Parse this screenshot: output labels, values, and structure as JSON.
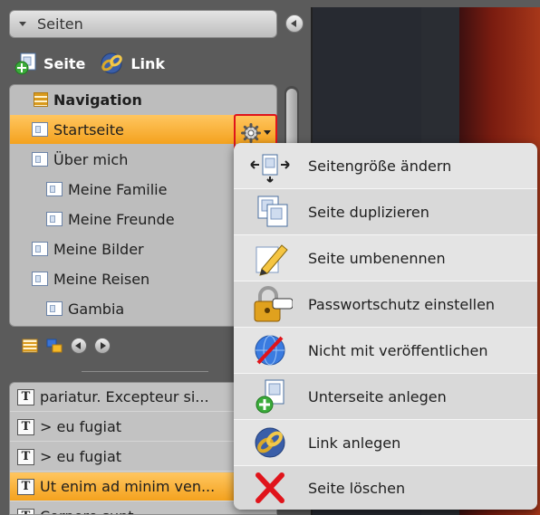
{
  "panel": {
    "section_title": "Seiten"
  },
  "toolbar": {
    "page_label": "Seite",
    "link_label": "Link"
  },
  "tree": {
    "items": [
      {
        "label": "Navigation",
        "level": 0,
        "type": "root"
      },
      {
        "label": "Startseite",
        "level": 0,
        "type": "page",
        "selected": true
      },
      {
        "label": "Über mich",
        "level": 0,
        "type": "page"
      },
      {
        "label": "Meine Familie",
        "level": 1,
        "type": "page"
      },
      {
        "label": "Meine Freunde",
        "level": 1,
        "type": "page"
      },
      {
        "label": "Meine Bilder",
        "level": 0,
        "type": "page"
      },
      {
        "label": "Meine Reisen",
        "level": 0,
        "type": "page"
      },
      {
        "label": "Gambia",
        "level": 1,
        "type": "page"
      }
    ]
  },
  "elements": {
    "items": [
      {
        "label": "pariatur. Excepteur si..."
      },
      {
        "label": "> eu fugiat"
      },
      {
        "label": "> eu fugiat"
      },
      {
        "label": "Ut enim ad minim ven...",
        "selected": true
      },
      {
        "label": "Corpore sunt"
      }
    ]
  },
  "context_menu": {
    "items": [
      {
        "label": "Seitengröße ändern",
        "icon": "resize-page-icon"
      },
      {
        "label": "Seite duplizieren",
        "icon": "duplicate-page-icon"
      },
      {
        "label": "Seite umbenennen",
        "icon": "rename-pencil-icon"
      },
      {
        "label": "Passwortschutz einstellen",
        "icon": "padlock-icon"
      },
      {
        "label": "Nicht mit veröffentlichen",
        "icon": "unpublish-globe-icon"
      },
      {
        "label": "Unterseite anlegen",
        "icon": "add-subpage-icon"
      },
      {
        "label": "Link anlegen",
        "icon": "chain-link-icon"
      },
      {
        "label": "Seite löschen",
        "icon": "delete-x-icon"
      }
    ]
  },
  "colors": {
    "selection": "#f4a21e",
    "highlight_border": "#e0141b",
    "panel_bg": "#5b5b5b"
  }
}
